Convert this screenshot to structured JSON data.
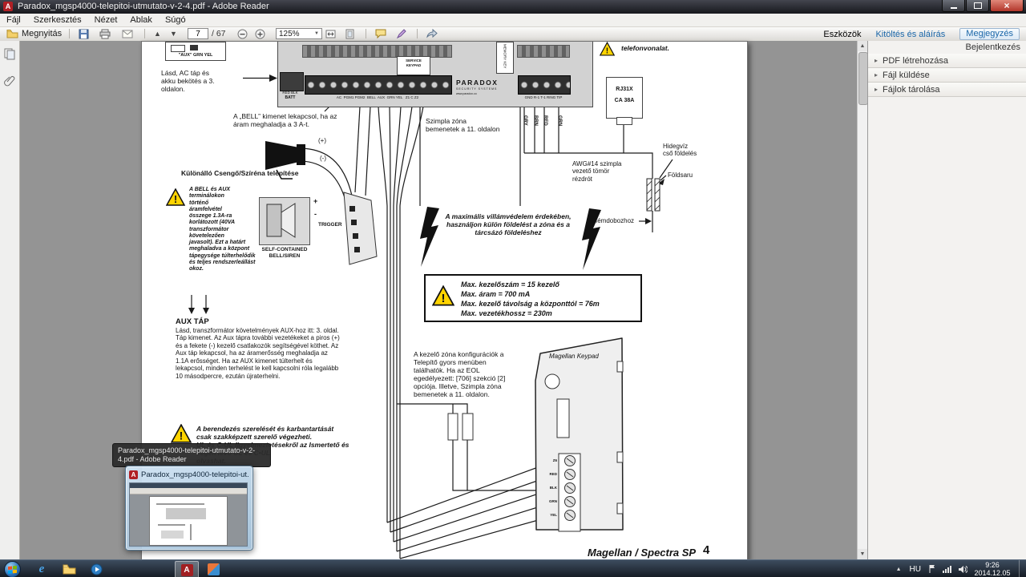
{
  "window": {
    "title": "Paradox_mgsp4000-telepitoi-utmutato-v-2-4.pdf - Adobe Reader"
  },
  "menu": {
    "items": [
      "Fájl",
      "Szerkesztés",
      "Nézet",
      "Ablak",
      "Súgó"
    ]
  },
  "toolbar": {
    "open": "Megnyitás",
    "page_current": "7",
    "page_total": "/ 67",
    "zoom": "125%",
    "tools": "Eszközök",
    "fill_sign": "Kitöltés és aláírás",
    "comment": "Megjegyzés"
  },
  "icons": {
    "panel_arrow": "▸",
    "up": "▲",
    "down": "▼",
    "caret": "▼",
    "close": "×",
    "tray_chevron": "▲",
    "adobe_glyph": "A",
    "ie_glyph": "e"
  },
  "panel_right": {
    "sign_in": "Bejelentkezés",
    "items": [
      "PDF létrehozása",
      "Fájl küldése",
      "Fájlok tárolása"
    ]
  },
  "doc": {
    "aux_box": "\"AUX\"  GRN YEL",
    "note_ac": "Lásd, AC táp és\nakku bekötés a  3.\noldalon.",
    "note_bell": "A „BELL” kimenet lekapcsol, ha az\náram meghaladja a 3 A-t.",
    "plus": "(+)",
    "minus": "(-)",
    "bell_title": "Különálló Csengő/Szíréna telepítése",
    "warn_bell_aux": "A BELL és AUX\nterminálokon\ntörténő\náramfelvétel\nösszege 1.3A-ra\nkorlátozott (40VA\ntranszformátor\nkövetelezően\njavasolt). Ezt a határt\nmeghaladva a központ\ntápegysége túlterhelődik\nés teljes rendszerleállást\nokoz.",
    "self_contained": "SELF-CONTAINED\nBELL/SIREN",
    "term_plus": "+",
    "term_minus": "-",
    "trigger": "TRIGGER",
    "zone_note": "Szimpla zóna\nbemenetek a  11. oldalon",
    "phone_note": "telefonvonalat.",
    "rj31x": "RJ31X\nCA 38A",
    "wire_colors": [
      "GRY",
      "BRN",
      "RED",
      "GRN"
    ],
    "awg_note": "AWG#14 szimpla\nvezető tömör\nrézdrót",
    "coldwater": "Hidegvíz\ncső földelés",
    "foldsaru": "Földsaru",
    "femdoboz": "fémdobozhoz",
    "lightning_note": "A maximális villámvédelem érdekében,\nhasználjon külön földelést a zóna és a\ntárcsázó földeléshez",
    "max_box": "Max. kezelőszám = 15 kezelő\nMax. áram = 700 mA\nMax. kezelő távolság a központtól = 76m\nMax. vezetékhossz = 230m",
    "aux_title": "AUX TÁP",
    "aux_body": "Lásd, transzformátor követelmények AUX-hoz itt: 3. oldal.\nTáp kimenet. Az Aux tápra további vezetékeket a piros (+)\nés a fekete (-) kezelő csatlakozók segítségével köthet. Az\nAux táp lekapcsol, ha az áramerősség meghaladja az\n1.1A erősséget. Ha az AUX kimenet túlterhelt és\nlekapcsol, minden terhelést le kell kapcsolni róla legalább\n10 másodpercre, ezután újraterhelni.",
    "warn_service": "A berendezés szerelését és karbantartását\ncsak szakképzett szerelő végezheti.\nUL és C-UL figyelmeztetésekről az Ismertető és\nvégén lévő UL és C•UL\nolvashat.",
    "keypad_note": "A kezelő zóna konfigurációk a\nTelepítő gyors menüben\ntalálhatók. Ha az EOL\negedélyezett: [706] szekció [2]\nopciója. Illetve, Szimpla zóna\nbemenetek a  11. oldalon.",
    "keypad_label": "Magellan  Keypad",
    "keypad_terminals": [
      "Z6",
      "RED",
      "BLK",
      "GRN",
      "YEL"
    ],
    "footer": "Magellan / Spectra SP",
    "footer_page": "4",
    "pcb": {
      "brand": "PARADOX",
      "brand_sub": "SECURITY SYSTEMS",
      "brand_url": "www.paradox.co",
      "batt_wires": "RED BLK",
      "batt": "BATT",
      "left_terminals": "AC  PGM1 PGM2  BELL  AUX  GRN YEL   Z1 C Z2",
      "right_terminals": "GND R-1 T-1 RING TIP",
      "service_keypad": "SERVICE\nKEYPAD",
      "memory_key": "MEMORY KEY"
    }
  },
  "preview": {
    "tooltip": "Paradox_mgsp4000-telepitoi-utmutato-v-2-4.pdf - Adobe Reader",
    "title": "Paradox_mgsp4000-telepitoi-ut..."
  },
  "taskbar": {
    "lang": "HU",
    "time": "9:26",
    "date": "2014.12.05"
  }
}
